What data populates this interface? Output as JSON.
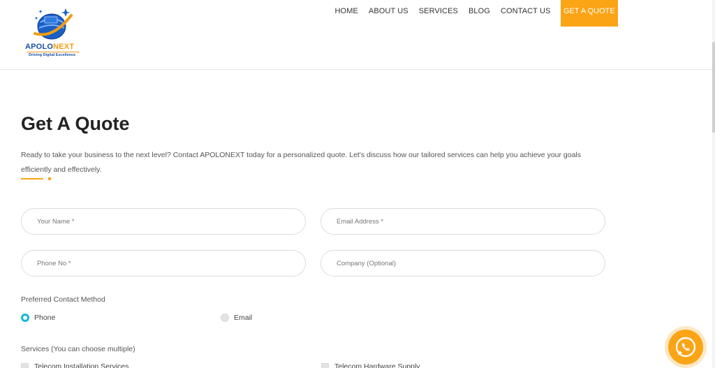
{
  "brand": {
    "name_part1": "APOLO",
    "name_part2": "NEXT",
    "tagline": "Driving Digital Excellence"
  },
  "nav": {
    "items": [
      "HOME",
      "ABOUT US",
      "SERVICES",
      "BLOG",
      "CONTACT US"
    ],
    "cta": "GET A QUOTE"
  },
  "page": {
    "title": "Get A Quote",
    "intro": "Ready to take your business to the next level? Contact APOLONEXT today for a personalized quote. Let's discuss how our tailored services can help you achieve your goals efficiently and effectively."
  },
  "form": {
    "name_placeholder": "Your Name *",
    "email_placeholder": "Email Address *",
    "phone_placeholder": "Phone No *",
    "company_placeholder": "Company (Optional)",
    "contact_method_label": "Preferred Contact Method",
    "contact_options": [
      "Phone",
      "Email"
    ],
    "contact_selected": "Phone",
    "services_label": "Services (You can choose multiple)",
    "services": [
      "Telecom Installation Services",
      "Telecom Hardware Supply"
    ]
  },
  "colors": {
    "accent": "#fba416",
    "radio_selected": "#13b9d6",
    "brand_blue": "#1a4fa8"
  },
  "icons": {
    "chat": "whatsapp-icon"
  }
}
